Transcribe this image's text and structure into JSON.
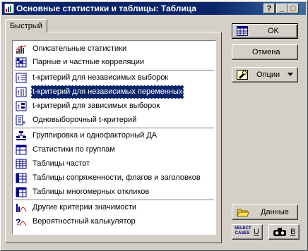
{
  "window": {
    "title": "Основные статистики и таблицы: Таблица",
    "help_button": "?",
    "minimize_button": "_",
    "maximize_button": "□",
    "close_button": "✕"
  },
  "tabs": [
    {
      "label": "Быстрый"
    }
  ],
  "list": {
    "items": [
      {
        "label": "Описательные статистики",
        "icon": "descriptive-stats-icon"
      },
      {
        "label": "Парные и частные корреляции",
        "icon": "correlations-icon"
      },
      {
        "label": "t-критерий для независимых выборок",
        "icon": "t-test-groups-icon"
      },
      {
        "label": "t-критерий для независимых переменных",
        "icon": "t-test-variables-icon",
        "selected": true
      },
      {
        "label": "t-критерий для зависимых выборок",
        "icon": "t-test-dependent-icon"
      },
      {
        "label": "Одновыборочный t-критерий",
        "icon": "one-sample-t-icon"
      },
      {
        "label": "Группировка и однофакторный ДА",
        "icon": "breakdown-icon"
      },
      {
        "label": "Статистики по группам",
        "icon": "group-stats-icon"
      },
      {
        "label": "Таблицы частот",
        "icon": "frequency-tables-icon"
      },
      {
        "label": "Таблицы сопряженности, флагов и заголовков",
        "icon": "crosstab-icon"
      },
      {
        "label": "Таблицы многомерных откликов",
        "icon": "multiple-response-icon"
      },
      {
        "label": "Другие критерии значимости",
        "icon": "significance-tests-icon"
      },
      {
        "label": "Вероятностный калькулятор",
        "icon": "probability-calculator-icon"
      }
    ]
  },
  "buttons": {
    "ok": "OK",
    "cancel": "Отмена",
    "options": "Опции",
    "data": "Данные",
    "select_cases_icon_text": "SELECT CASES",
    "select_cases_key": "U",
    "weight_key": "B"
  }
}
